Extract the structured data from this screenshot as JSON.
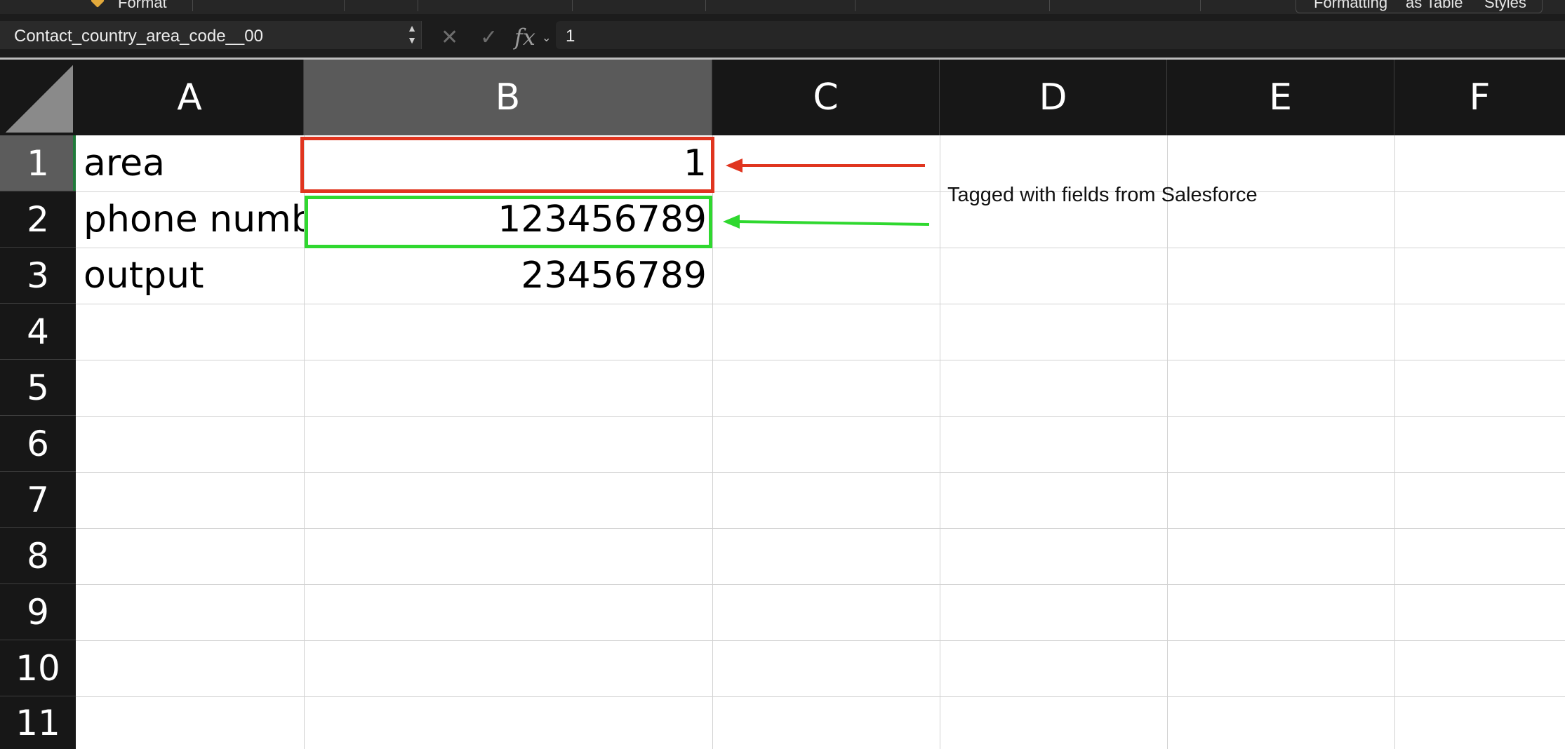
{
  "ribbon": {
    "format_label": "Format",
    "styles_labels": [
      "Formatting",
      "as Table",
      "Styles"
    ]
  },
  "formula_bar": {
    "name_box": "Contact_country_area_code__00",
    "cancel_icon": "x-icon",
    "confirm_icon": "checkmark-icon",
    "fx_label": "fx",
    "value": "1"
  },
  "columns": [
    "A",
    "B",
    "C",
    "D",
    "E",
    "F"
  ],
  "selected_column": "B",
  "rows": [
    "1",
    "2",
    "3",
    "4",
    "5",
    "6",
    "7",
    "8",
    "9",
    "10",
    "11"
  ],
  "selected_row": "1",
  "cells": {
    "A1": "area",
    "B1": "1",
    "A2": "phone number",
    "B2": "123456789",
    "A3": "output",
    "B3": "23456789"
  },
  "annotation": {
    "text": "Tagged with fields from Salesforce",
    "red_color": "#e0351f",
    "green_color": "#2fd82f"
  }
}
